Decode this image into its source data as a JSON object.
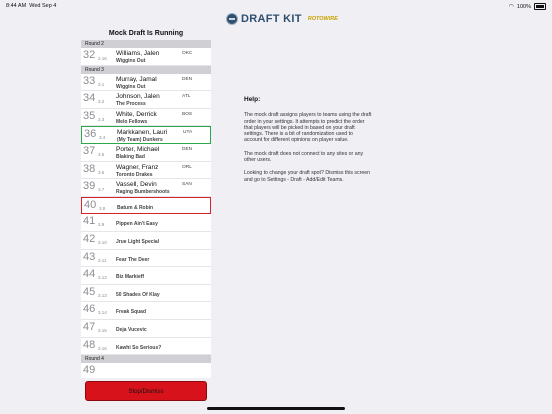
{
  "status": {
    "time": "8:44 AM",
    "date": "Wed Sep 4",
    "battery": "100%"
  },
  "logo": {
    "main": "DRAFT KIT",
    "sub": "ROTOWIRE"
  },
  "panel": {
    "title": "Mock Draft Is Running"
  },
  "list": [
    {
      "kind": "round",
      "label": "Round 2"
    },
    {
      "kind": "pick",
      "num": "32",
      "sub": "2.16",
      "name": "Williams, Jalen",
      "team": "Wiggins Out",
      "pos": "OKC",
      "style": ""
    },
    {
      "kind": "round",
      "label": "Round 3"
    },
    {
      "kind": "pick",
      "num": "33",
      "sub": "3.1",
      "name": "Murray, Jamal",
      "team": "Wiggins Out",
      "pos": "DEN",
      "style": ""
    },
    {
      "kind": "pick",
      "num": "34",
      "sub": "3.2",
      "name": "Johnson, Jalen",
      "team": "The Process",
      "pos": "ATL",
      "style": ""
    },
    {
      "kind": "pick",
      "num": "35",
      "sub": "3.3",
      "name": "White, Derrick",
      "team": "Melo Fellows",
      "pos": "BOS",
      "style": ""
    },
    {
      "kind": "pick",
      "num": "36",
      "sub": "3.4",
      "name": "Markkanen, Lauri",
      "team": "(My Team) Dunkers",
      "pos": "UTA",
      "style": "green"
    },
    {
      "kind": "pick",
      "num": "37",
      "sub": "3.5",
      "name": "Porter, Michael",
      "team": "Blaking Bad",
      "pos": "DEN",
      "style": ""
    },
    {
      "kind": "pick",
      "num": "38",
      "sub": "3.6",
      "name": "Wagner, Franz",
      "team": "Toronto Drakes",
      "pos": "ORL",
      "style": ""
    },
    {
      "kind": "pick",
      "num": "39",
      "sub": "3.7",
      "name": "Vassell, Devin",
      "team": "Raging Bumbershoots",
      "pos": "SAN",
      "style": ""
    },
    {
      "kind": "pick",
      "num": "40",
      "sub": "3.8",
      "name": "",
      "team": "Batum & Robin",
      "pos": "",
      "style": "red"
    },
    {
      "kind": "pick",
      "num": "41",
      "sub": "3.9",
      "name": "",
      "team": "Pippen Ain't Easy",
      "pos": "",
      "style": ""
    },
    {
      "kind": "pick",
      "num": "42",
      "sub": "3.10",
      "name": "",
      "team": "Jrue Light Special",
      "pos": "",
      "style": ""
    },
    {
      "kind": "pick",
      "num": "43",
      "sub": "3.11",
      "name": "",
      "team": "Fear The Deer",
      "pos": "",
      "style": ""
    },
    {
      "kind": "pick",
      "num": "44",
      "sub": "3.12",
      "name": "",
      "team": "Biz Markieff",
      "pos": "",
      "style": ""
    },
    {
      "kind": "pick",
      "num": "45",
      "sub": "3.13",
      "name": "",
      "team": "50 Shades Of Klay",
      "pos": "",
      "style": ""
    },
    {
      "kind": "pick",
      "num": "46",
      "sub": "3.14",
      "name": "",
      "team": "Freak Squad",
      "pos": "",
      "style": ""
    },
    {
      "kind": "pick",
      "num": "47",
      "sub": "3.15",
      "name": "",
      "team": "Deja Vucevic",
      "pos": "",
      "style": ""
    },
    {
      "kind": "pick",
      "num": "48",
      "sub": "3.16",
      "name": "",
      "team": "Kawhi So Serious?",
      "pos": "",
      "style": ""
    },
    {
      "kind": "round",
      "label": "Round 4"
    },
    {
      "kind": "pick",
      "num": "49",
      "sub": "",
      "name": "",
      "team": "",
      "pos": "",
      "style": ""
    }
  ],
  "stop_button": {
    "label": "Stop/Dismiss"
  },
  "help": {
    "title": "Help:",
    "p1": "The mock draft assigns players to teams using the draft order in your settings. It attempts to predict the order that players will be picked in based on your draft settings. There is a bit of randomization used to account for different opinions on player value.",
    "p2": "The mock draft does not connect to any sites or any other users.",
    "p3": "Looking to change your draft spot? Dismiss this screen and go to Settings - Draft - Add/Edit Teams."
  }
}
